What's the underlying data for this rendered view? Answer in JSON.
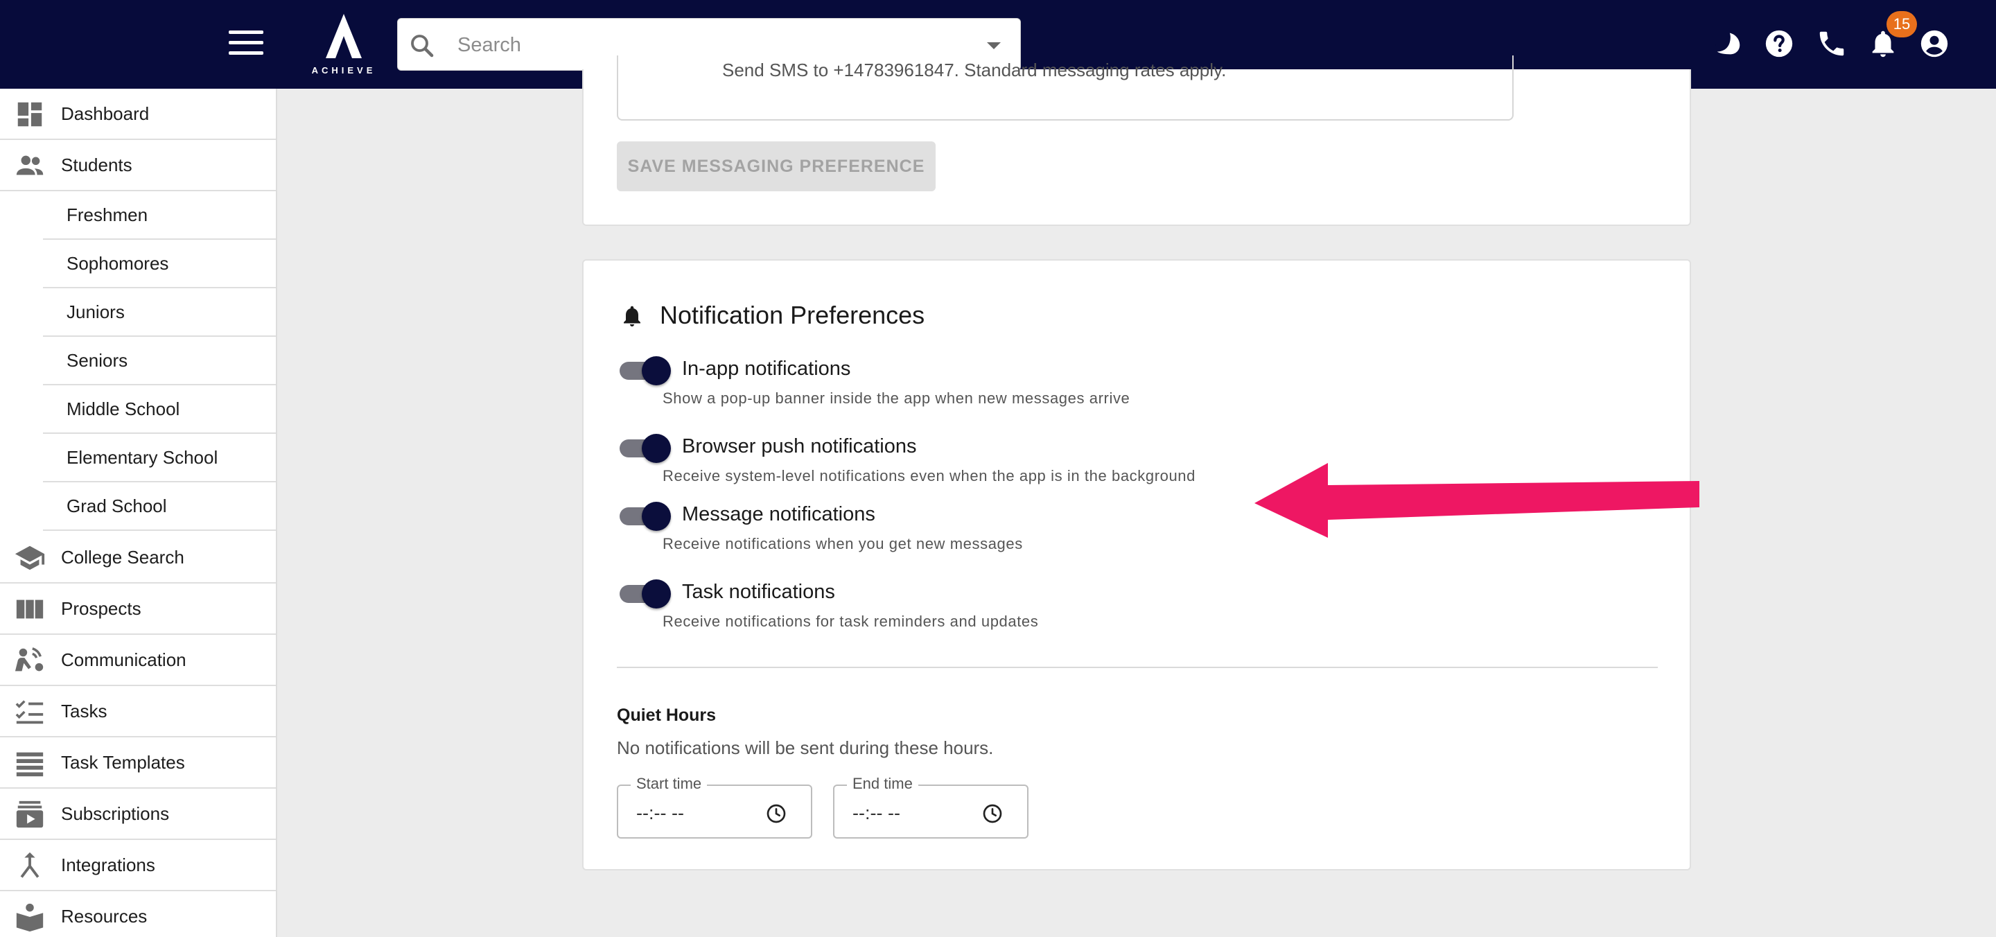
{
  "header": {
    "logo_text": "ACHIEVE",
    "search_placeholder": "Search",
    "notification_count": "15",
    "icons": [
      "menu-icon",
      "dark-mode-icon",
      "help-icon",
      "phone-icon",
      "bell-icon",
      "account-icon"
    ]
  },
  "sidebar": {
    "items": [
      {
        "label": "Dashboard",
        "icon": "dashboard-icon"
      },
      {
        "label": "Students",
        "icon": "people-icon"
      },
      {
        "label": "College Search",
        "icon": "school-icon"
      },
      {
        "label": "Prospects",
        "icon": "columns-icon"
      },
      {
        "label": "Communication",
        "icon": "communication-icon"
      },
      {
        "label": "Tasks",
        "icon": "checklist-icon"
      },
      {
        "label": "Task Templates",
        "icon": "list-icon"
      },
      {
        "label": "Subscriptions",
        "icon": "subscriptions-icon"
      },
      {
        "label": "Integrations",
        "icon": "merge-icon"
      },
      {
        "label": "Resources",
        "icon": "book-icon"
      }
    ],
    "student_subitems": [
      "Freshmen",
      "Sophomores",
      "Juniors",
      "Seniors",
      "Middle School",
      "Elementary School",
      "Grad School"
    ]
  },
  "messaging": {
    "partial_text": "Send SMS to +14783961847. Standard messaging rates apply.",
    "save_button": "SAVE MESSAGING PREFERENCE"
  },
  "notifications": {
    "title": "Notification Preferences",
    "options": [
      {
        "title": "In-app notifications",
        "desc": "Show a pop-up banner inside the app when new messages arrive",
        "enabled": true
      },
      {
        "title": "Browser push notifications",
        "desc": "Receive system-level notifications even when the app is in the background",
        "enabled": true
      },
      {
        "title": "Message notifications",
        "desc": "Receive notifications when you get new messages",
        "enabled": true
      },
      {
        "title": "Task notifications",
        "desc": "Receive notifications for task reminders and updates",
        "enabled": true
      }
    ],
    "quiet_hours": {
      "title": "Quiet Hours",
      "desc": "No notifications will be sent during these hours.",
      "start_label": "Start time",
      "end_label": "End time",
      "start_value": "--:-- --",
      "end_value": "--:-- --"
    }
  },
  "colors": {
    "topbar": "#070b3b",
    "badge": "#e8701c",
    "toggle_knob": "#0b0e3c",
    "annotation_arrow": "#ee1763"
  }
}
